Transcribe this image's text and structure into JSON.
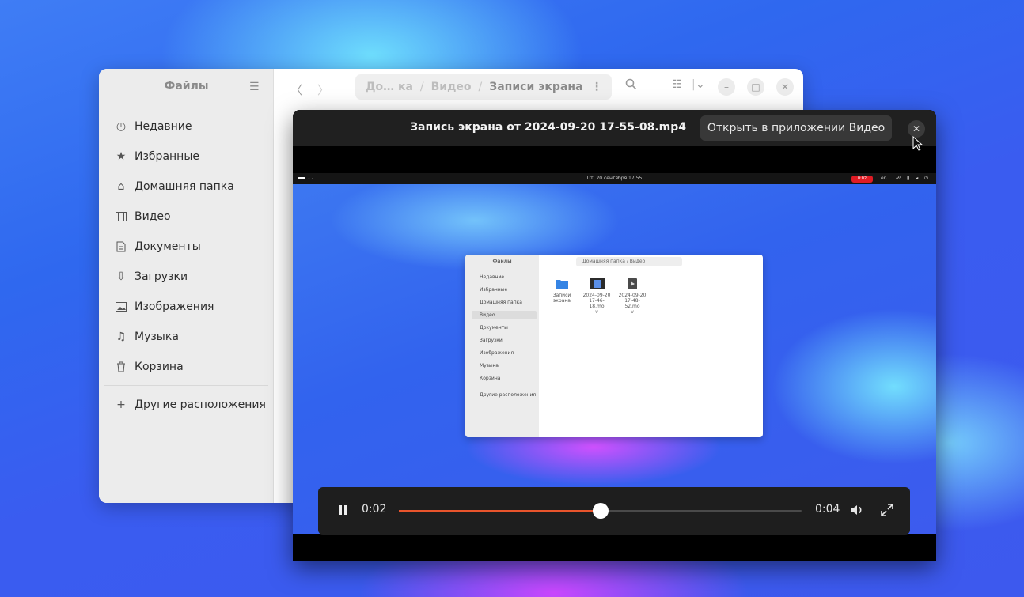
{
  "files_window": {
    "title": "Файлы",
    "sidebar": [
      {
        "icon": "clock-icon",
        "label": "Недавние"
      },
      {
        "icon": "star-icon",
        "label": "Избранные"
      },
      {
        "icon": "home-icon",
        "label": "Домашняя папка"
      },
      {
        "icon": "film-icon",
        "label": "Видео"
      },
      {
        "icon": "document-icon",
        "label": "Документы"
      },
      {
        "icon": "download-icon",
        "label": "Загрузки"
      },
      {
        "icon": "image-icon",
        "label": "Изображения"
      },
      {
        "icon": "music-icon",
        "label": "Музыка"
      },
      {
        "icon": "trash-icon",
        "label": "Корзина"
      }
    ],
    "other_locations": "Другие расположения",
    "breadcrumb": [
      "До… ка",
      "Видео",
      "Записи экрана"
    ]
  },
  "viewer": {
    "title": "Запись экрана от 2024-09-20 17-55-08.mp4",
    "open_button": "Открыть в приложении Видео",
    "controls": {
      "elapsed": "0:02",
      "duration": "0:04",
      "progress_fraction": 0.5
    },
    "frame": {
      "topbar": {
        "clock": "Пт, 20 сентября 17:55",
        "rec": "0:02",
        "lang": "en"
      },
      "mini_files": {
        "title": "Файлы",
        "breadcrumb": "Домашняя папка  /  Видео",
        "sidebar": [
          "Недавние",
          "Избранные",
          "Домашняя папка",
          "Видео",
          "Документы",
          "Загрузки",
          "Изображения",
          "Музыка",
          "Корзина",
          "Другие расположения"
        ],
        "files": [
          {
            "name_line1": "Записи",
            "name_line2": "экрана",
            "name_line3": ""
          },
          {
            "name_line1": "2024-09-20",
            "name_line2": "17-46-18.mo",
            "name_line3": "v"
          },
          {
            "name_line1": "2024-09-20",
            "name_line2": "17-48-52.mo",
            "name_line3": "v"
          }
        ]
      }
    }
  },
  "colors": {
    "accent": "#e9542c",
    "record": "#e01b24"
  }
}
